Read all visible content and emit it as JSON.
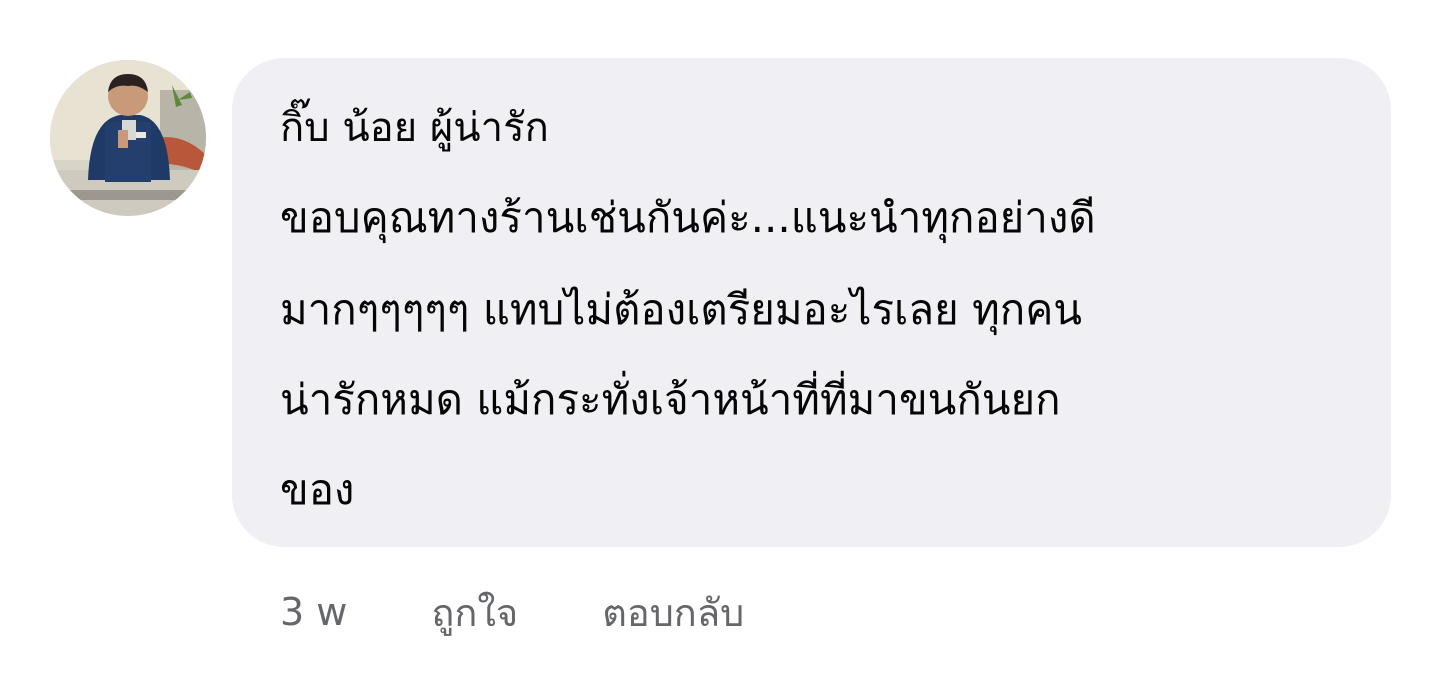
{
  "comment": {
    "author": "กิ๊บ น้อย ผู้น่ารัก",
    "lines": [
      "ขอบคุณทางร้านเช่นกันค่ะ...แนะนำทุกอย่างดี",
      "มากๆๆๆๆๆ แทบไม่ต้องเตรียมอะไรเลย ทุกคน",
      "น่ารักหมด แม้กระทั่งเจ้าหน้าที่ที่มาขนกันยก",
      "ของ"
    ]
  },
  "actions": {
    "time": "3 w",
    "like": "ถูกใจ",
    "reply": "ตอบกลับ"
  },
  "colors": {
    "bubble_bg": "#f0f0f4",
    "text": "#050505",
    "meta_text": "#65676b"
  },
  "icons": {
    "avatar": "profile-photo"
  }
}
